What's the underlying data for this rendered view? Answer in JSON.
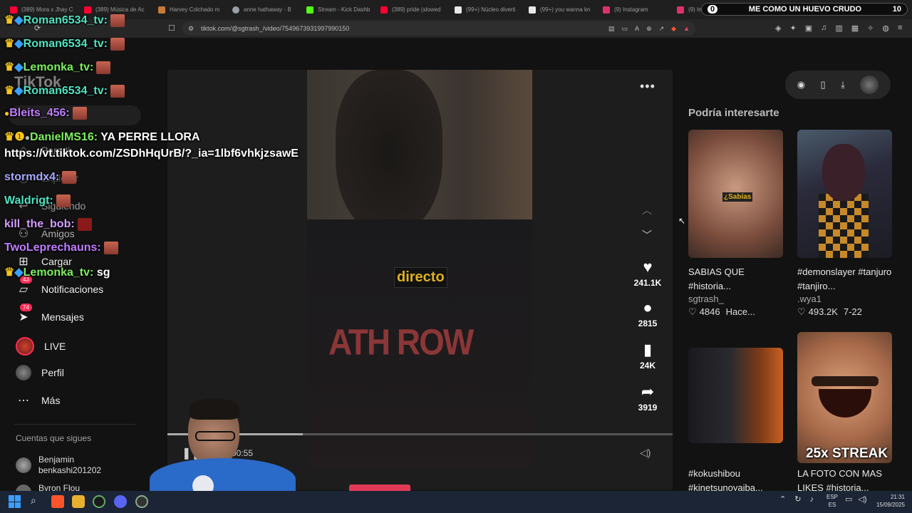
{
  "browser": {
    "tabs": [
      {
        "title": "(389) Mora x Jhay C",
        "color": "#ff0033"
      },
      {
        "title": "(389) Música de Ac",
        "color": "#ff0033"
      },
      {
        "title": "Harvey Colchado m",
        "color": "#c87a3a"
      },
      {
        "title": "anne hathaway - B",
        "color": "#9aa0a6"
      },
      {
        "title": "Stream - Kick Dashb",
        "color": "#53fc18"
      },
      {
        "title": "(389) pride (slowed",
        "color": "#ff0033"
      },
      {
        "title": "(99+) Núcleo diverti",
        "color": "#e8e8e8"
      },
      {
        "title": "(99+) you wanna kn",
        "color": "#e8e8e8"
      },
      {
        "title": "(9) Instagram",
        "color": "#e1306c"
      },
      {
        "title": "(9) Inst",
        "color": "#e1306c"
      }
    ],
    "url": "tiktok.com/@sgtrash_/video/7549673931997990150"
  },
  "stream_bar": {
    "left": "0",
    "title": "ME COMO UN HUEVO CRUDO",
    "right": "10"
  },
  "sidebar": {
    "logo": "TikTok",
    "items": [
      {
        "label": "Para ti",
        "icon": "home-icon"
      },
      {
        "label": "Explorar",
        "icon": "compass-icon"
      },
      {
        "label": "Siguiendo",
        "icon": "following-icon"
      },
      {
        "label": "Amigos",
        "icon": "friends-icon"
      },
      {
        "label": "Cargar",
        "icon": "upload-icon"
      },
      {
        "label": "Notificaciones",
        "icon": "notifications-icon",
        "badge": "43"
      },
      {
        "label": "Mensajes",
        "icon": "messages-icon",
        "badge": "74"
      },
      {
        "label": "LIVE",
        "icon": "live-icon"
      },
      {
        "label": "Perfil",
        "icon": "profile-icon"
      },
      {
        "label": "Más",
        "icon": "more-icon"
      }
    ],
    "following_header": "Cuentas que sigues",
    "following": [
      {
        "name": "Benjamin",
        "handle": "benkashi201202"
      },
      {
        "name": "Byron Flou",
        "handle": ""
      }
    ]
  },
  "chat": [
    {
      "user": "Roman6534_tv:",
      "msg": "",
      "color": "#4fe3c1"
    },
    {
      "user": "Roman6534_tv:",
      "msg": "",
      "color": "#4fe3c1"
    },
    {
      "user": "Lemonka_tv:",
      "msg": "",
      "color": "#7cf05c"
    },
    {
      "user": "Roman6534_tv:",
      "msg": "",
      "color": "#4fe3c1"
    },
    {
      "user": "Bleits_456:",
      "msg": "",
      "color": "#c07cff"
    },
    {
      "user": "DanielMS16:",
      "msg": "YA PERRE LLORA",
      "color": "#7cf05c"
    },
    {
      "user": "",
      "msg": "https://vt.tiktok.com/ZSDhHqUrB/?_ia=1lbf6vhkjzsawE",
      "color": "#ffffff"
    },
    {
      "user": "stormdx4:",
      "msg": "",
      "color": "#a8a8ff"
    },
    {
      "user": "Waldrigt:",
      "msg": "",
      "color": "#4fe3c1"
    },
    {
      "user": "kill_the_bob:",
      "msg": "",
      "color": "#d49cff"
    },
    {
      "user": "TwoLeprechauns:",
      "msg": "",
      "color": "#c07cff"
    },
    {
      "user": "Lemonka_tv:",
      "msg": "sg",
      "color": "#7cf05c"
    }
  ],
  "video": {
    "caption_overlay": "directo",
    "shirt_text": "ATH ROW",
    "time": "00:55"
  },
  "actions": {
    "likes": "241.1K",
    "comments": "2815",
    "saves": "24K",
    "shares": "3919"
  },
  "recommended": {
    "header": "Podría interesarte",
    "cards": [
      {
        "title": "SABIAS QUE #historia...",
        "author": "sgtrash_",
        "likes": "4846",
        "date": "Hace...",
        "overlay": "¿Sabías"
      },
      {
        "title": "#demonslayer #tanjuro #tanjiro...",
        "author": ".wya1",
        "likes": "493.2K",
        "date": "7-22",
        "overlay": ""
      },
      {
        "title": "#kokushibou #kinetsunoyaiba...",
        "author": "",
        "likes": "",
        "date": "",
        "overlay": ""
      },
      {
        "title": "LA FOTO CON MAS LIKES #historia...",
        "author": "",
        "likes": "",
        "date": "",
        "overlay": "25x STREAK"
      }
    ]
  },
  "taskbar": {
    "lang_top": "ESP",
    "lang_bottom": "ES",
    "time": "21:31",
    "date": "15/09/2025"
  }
}
